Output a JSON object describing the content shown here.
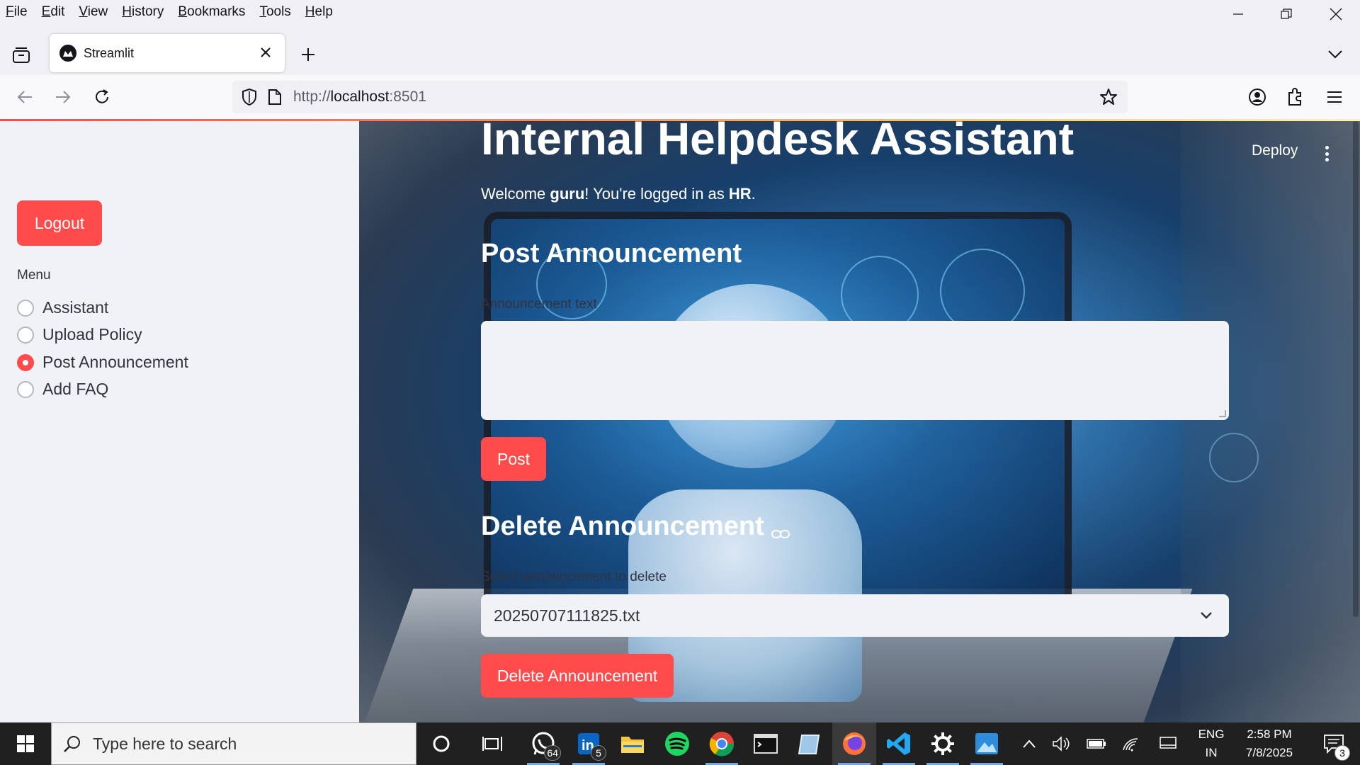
{
  "browser": {
    "menu": [
      {
        "key": "F",
        "rest": "ile"
      },
      {
        "key": "E",
        "rest": "dit"
      },
      {
        "key": "V",
        "rest": "iew"
      },
      {
        "key": "H",
        "rest": "istory"
      },
      {
        "key": "B",
        "rest": "ookmarks"
      },
      {
        "key": "T",
        "rest": "ools"
      },
      {
        "key": "H",
        "rest": "elp"
      }
    ],
    "tab_title": "Streamlit",
    "url_prefix": "http://",
    "url_host": "localhost",
    "url_port": ":8501"
  },
  "sidebar": {
    "logout_label": "Logout",
    "menu_label": "Menu",
    "options": [
      {
        "label": "Assistant",
        "selected": false
      },
      {
        "label": "Upload Policy",
        "selected": false
      },
      {
        "label": "Post Announcement",
        "selected": true
      },
      {
        "label": "Add FAQ",
        "selected": false
      }
    ]
  },
  "header": {
    "deploy_label": "Deploy"
  },
  "main": {
    "title": "Internal Helpdesk Assistant",
    "welcome_prefix": "Welcome ",
    "user": "guru",
    "welcome_mid": "! You're logged in as ",
    "role": "HR",
    "welcome_suffix": ".",
    "post_heading": "Post Announcement",
    "announcement_label": "Announcement text",
    "announcement_value": "",
    "post_button": "Post",
    "delete_heading": "Delete Announcement",
    "select_label": "Select announcement to delete",
    "selected_file": "20250707111825.txt",
    "delete_button": "Delete Announcement"
  },
  "taskbar": {
    "search_placeholder": "Type here to search",
    "whatsapp_badge": "64",
    "linkedin_badge": "5",
    "lang_1": "ENG",
    "lang_2": "IN",
    "time": "2:58 PM",
    "date": "7/8/2025",
    "notif_count": "3"
  },
  "colors": {
    "accent": "#ff4b4b",
    "sidebar_bg": "#f0f2f6",
    "taskbar_bg": "#202020"
  }
}
